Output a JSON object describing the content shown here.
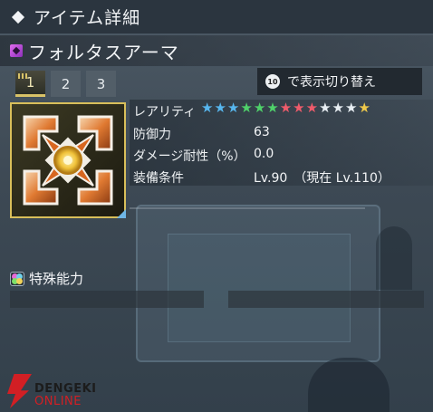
{
  "header": {
    "title": "アイテム詳細"
  },
  "item": {
    "name": "フォルタスアーマ"
  },
  "tabs": [
    {
      "label": "1",
      "active": true
    },
    {
      "label": "2",
      "active": false
    },
    {
      "label": "3",
      "active": false
    }
  ],
  "toggle": {
    "label": "で表示切り替え",
    "icon_text": "10"
  },
  "stats": {
    "rarity_label": "レアリティ",
    "rarity_stars": 13,
    "star_colors": [
      "#57b6ee",
      "#57b6ee",
      "#57b6ee",
      "#4fd16a",
      "#4fd16a",
      "#4fd16a",
      "#ef5b6b",
      "#ef5b6b",
      "#ef5b6b",
      "#e8eef3",
      "#e8eef3",
      "#e8eef3",
      "#f0c94a"
    ],
    "defense_label": "防御力",
    "defense_value": "63",
    "damage_label": "ダメージ耐性（%）",
    "damage_value": "0.0",
    "equip_label": "装備条件",
    "equip_value": "Lv.90　（現在 Lv.110）"
  },
  "special": {
    "label": "特殊能力"
  },
  "watermark": {
    "line1": "DENGEKI",
    "line2": "ONLINE"
  },
  "colors": {
    "accent_gold": "#d9bf5a",
    "brand_red": "#d21f24"
  }
}
